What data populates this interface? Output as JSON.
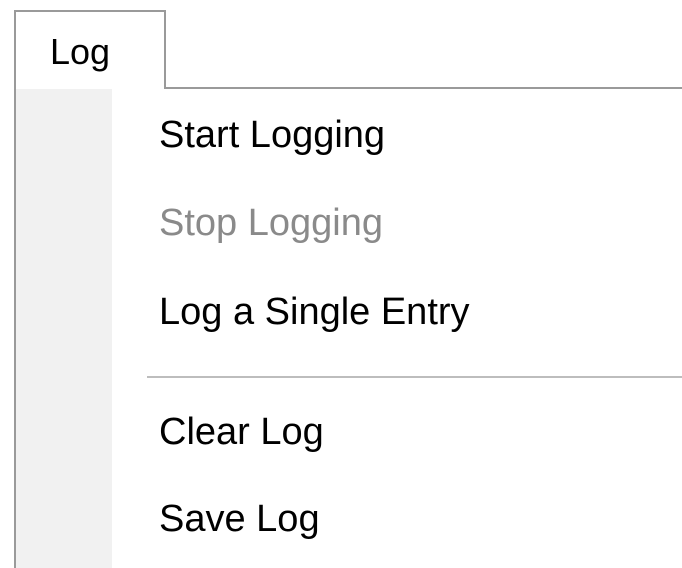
{
  "menu": {
    "title": "Log",
    "items": [
      {
        "label": "Start Logging",
        "enabled": true
      },
      {
        "label": "Stop Logging",
        "enabled": false
      },
      {
        "label": "Log a Single Entry",
        "enabled": true
      },
      {
        "label": "Clear Log",
        "enabled": true
      },
      {
        "label": "Save Log",
        "enabled": true
      }
    ]
  },
  "colors": {
    "border": "#9a9a9a",
    "gutter": "#f1f1f1",
    "separator": "#bdbdbd",
    "text": "#000000",
    "disabled_text": "#8a8a8a"
  }
}
